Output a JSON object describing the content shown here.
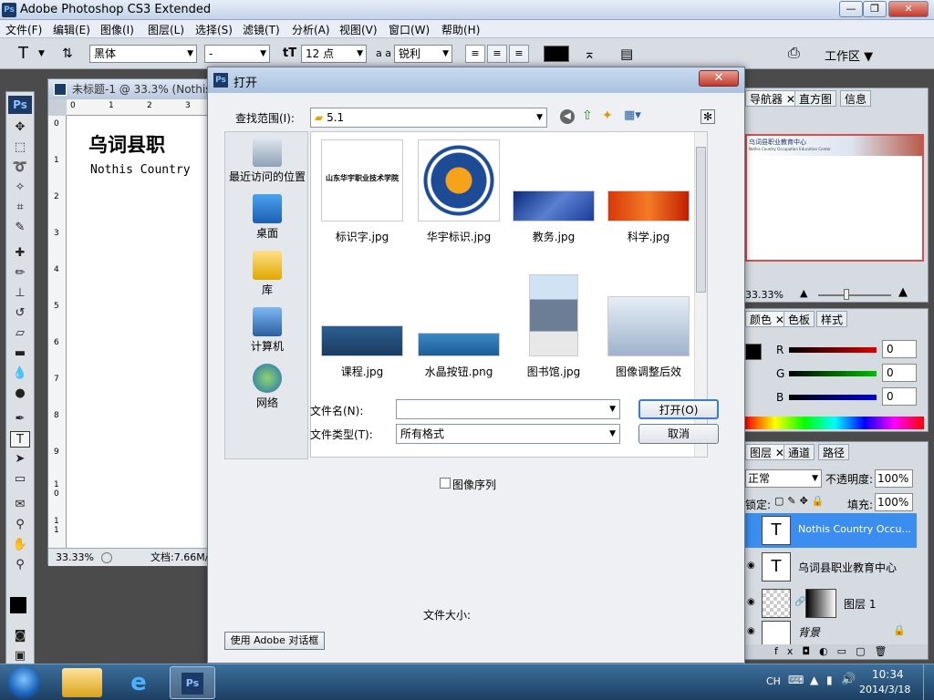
{
  "app": {
    "title": "Adobe Photoshop CS3 Extended",
    "logo": "Ps"
  },
  "window_buttons": [
    "—",
    "❐",
    "✕"
  ],
  "menu": [
    "文件(F)",
    "编辑(E)",
    "图像(I)",
    "图层(L)",
    "选择(S)",
    "滤镜(T)",
    "分析(A)",
    "视图(V)",
    "窗口(W)",
    "帮助(H)"
  ],
  "options": {
    "tool_glyph": "T",
    "font_family": "黑体",
    "font_style": "-",
    "font_size": "12 点",
    "aa_label": "a a",
    "aa_mode": "锐利",
    "workspace": "工作区"
  },
  "document": {
    "tab_title": "未标题-1 @ 33.3% (Nothis",
    "heading": "乌词县职",
    "subtext": "Nothis Country",
    "zoom": "33.33%",
    "doc_info": "文档:7.66M/",
    "ruler_h": [
      "0",
      "1",
      "2",
      "3"
    ],
    "ruler_v": [
      "0",
      "1",
      "2",
      "3",
      "4",
      "5",
      "6",
      "7",
      "8",
      "9",
      "1\n0",
      "1\n1"
    ]
  },
  "navigator": {
    "tabs": [
      "导航器",
      "直方图",
      "信息"
    ],
    "zoom": "33.33%",
    "preview_title": "乌词县职业教育中心",
    "preview_sub": "Nothis Country Occupation Education Center"
  },
  "color": {
    "tabs": [
      "颜色",
      "色板",
      "样式"
    ],
    "channels": [
      {
        "name": "R",
        "value": "0"
      },
      {
        "name": "G",
        "value": "0"
      },
      {
        "name": "B",
        "value": "0"
      }
    ]
  },
  "layers": {
    "tabs": [
      "图层",
      "通道",
      "路径"
    ],
    "blend": "正常",
    "opacity_label": "不透明度:",
    "opacity": "100%",
    "lock_label": "锁定:",
    "fill_label": "填充:",
    "fill": "100%",
    "items": [
      {
        "name": "Nothis Country Occu...",
        "kind": "T",
        "selected": true
      },
      {
        "name": "乌词县职业教育中心",
        "kind": "T",
        "selected": false
      },
      {
        "name": "图层 1",
        "kind": "mask",
        "selected": false
      },
      {
        "name": "背景",
        "kind": "bg",
        "selected": false
      }
    ]
  },
  "dialog": {
    "title": "打开",
    "lookin_label": "查找范围(I):",
    "folder": "5.1",
    "places": [
      "最近访问的位置",
      "桌面",
      "库",
      "计算机",
      "网络"
    ],
    "files": [
      "标识字.jpg",
      "华宇标识.jpg",
      "教务.jpg",
      "科学.jpg",
      "课程.jpg",
      "水晶按钮.png",
      "图书馆.jpg",
      "图像调整后效果.jpg"
    ],
    "thumb_caption_1": "山东华宇职业技术学院",
    "filename_label": "文件名(N):",
    "filename_value": "",
    "filetype_label": "文件类型(T):",
    "filetype_value": "所有格式",
    "open_button": "打开(O)",
    "cancel_button": "取消",
    "image_sequence": "图像序列",
    "filesize_label": "文件大小:",
    "adobe_dialog_button": "使用 Adobe 对话框"
  },
  "taskbar": {
    "lang": "CH",
    "time": "10:34",
    "date": "2014/3/18"
  }
}
